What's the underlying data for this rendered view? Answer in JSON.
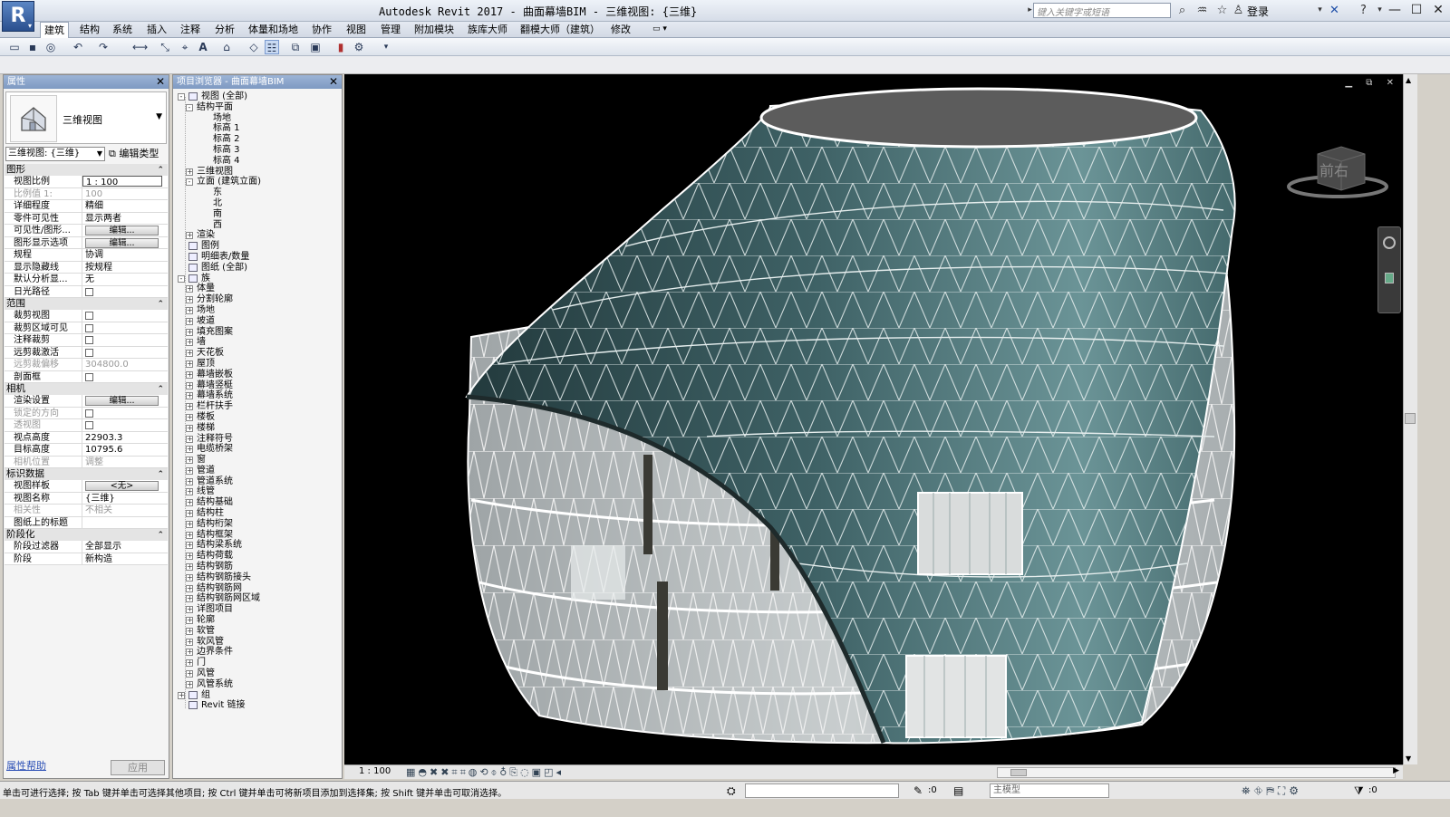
{
  "app": {
    "logo_letter": "R",
    "title": "Autodesk Revit 2017 -    曲面幕墙BIM - 三维视图: {三维}",
    "search_placeholder": "键入关键字或短语",
    "login": "登录"
  },
  "ribbon": {
    "tabs": [
      "建筑",
      "结构",
      "系统",
      "插入",
      "注释",
      "分析",
      "体量和场地",
      "协作",
      "视图",
      "管理",
      "附加模块",
      "族库大师",
      "翻模大师（建筑）",
      "修改"
    ],
    "active": "建筑"
  },
  "properties": {
    "panel_title": "属性",
    "type_name": "三维视图",
    "instance_selector": "三维视图: {三维}",
    "edit_type": "编辑类型",
    "sections": [
      {
        "title": "图形",
        "rows": [
          {
            "k": "视图比例",
            "v": "1 : 100",
            "kind": "input"
          },
          {
            "k": "比例值 1:",
            "v": "100",
            "dis": true
          },
          {
            "k": "详细程度",
            "v": "精细"
          },
          {
            "k": "零件可见性",
            "v": "显示两者"
          },
          {
            "k": "可见性/图形...",
            "v": "编辑...",
            "kind": "button"
          },
          {
            "k": "图形显示选项",
            "v": "编辑...",
            "kind": "button"
          },
          {
            "k": "规程",
            "v": "协调"
          },
          {
            "k": "显示隐藏线",
            "v": "按规程"
          },
          {
            "k": "默认分析显...",
            "v": "无"
          },
          {
            "k": "日光路径",
            "v": "",
            "kind": "check"
          }
        ]
      },
      {
        "title": "范围",
        "rows": [
          {
            "k": "裁剪视图",
            "v": "",
            "kind": "check"
          },
          {
            "k": "裁剪区域可见",
            "v": "",
            "kind": "check"
          },
          {
            "k": "注释裁剪",
            "v": "",
            "kind": "check"
          },
          {
            "k": "远剪裁激活",
            "v": "",
            "kind": "check"
          },
          {
            "k": "远剪裁偏移",
            "v": "304800.0",
            "dis": true
          },
          {
            "k": "剖面框",
            "v": "",
            "kind": "check"
          }
        ]
      },
      {
        "title": "相机",
        "rows": [
          {
            "k": "渲染设置",
            "v": "编辑...",
            "kind": "button"
          },
          {
            "k": "锁定的方向",
            "v": "",
            "kind": "check",
            "dis": true
          },
          {
            "k": "透视图",
            "v": "",
            "kind": "check",
            "dis": true
          },
          {
            "k": "视点高度",
            "v": "22903.3"
          },
          {
            "k": "目标高度",
            "v": "10795.6"
          },
          {
            "k": "相机位置",
            "v": "调整",
            "dis": true
          }
        ]
      },
      {
        "title": "标识数据",
        "rows": [
          {
            "k": "视图样板",
            "v": "<无>",
            "kind": "button"
          },
          {
            "k": "视图名称",
            "v": "{三维}"
          },
          {
            "k": "相关性",
            "v": "不相关",
            "dis": true
          },
          {
            "k": "图纸上的标题",
            "v": ""
          }
        ]
      },
      {
        "title": "阶段化",
        "rows": [
          {
            "k": "阶段过滤器",
            "v": "全部显示"
          },
          {
            "k": "阶段",
            "v": "新构造"
          }
        ]
      }
    ],
    "help_link": "属性帮助",
    "apply": "应用"
  },
  "browser": {
    "panel_title": "项目浏览器 - 曲面幕墙BIM",
    "nodes": [
      {
        "t": "视图 (全部)",
        "d": 0,
        "e": "-",
        "icon": true
      },
      {
        "t": "结构平面",
        "d": 1,
        "e": "-"
      },
      {
        "t": "场地",
        "d": 3
      },
      {
        "t": "标高 1",
        "d": 3
      },
      {
        "t": "标高 2",
        "d": 3
      },
      {
        "t": "标高 3",
        "d": 3
      },
      {
        "t": "标高 4",
        "d": 3
      },
      {
        "t": "三维视图",
        "d": 1,
        "e": "+"
      },
      {
        "t": "立面 (建筑立面)",
        "d": 1,
        "e": "-"
      },
      {
        "t": "东",
        "d": 3
      },
      {
        "t": "北",
        "d": 3
      },
      {
        "t": "南",
        "d": 3
      },
      {
        "t": "西",
        "d": 3
      },
      {
        "t": "渲染",
        "d": 1,
        "e": "+"
      },
      {
        "t": "图例",
        "d": 0,
        "icon": true
      },
      {
        "t": "明细表/数量",
        "d": 0,
        "icon": true
      },
      {
        "t": "图纸 (全部)",
        "d": 0,
        "icon": true
      },
      {
        "t": "族",
        "d": 0,
        "e": "-",
        "icon": true
      },
      {
        "t": "体量",
        "d": 1,
        "e": "+"
      },
      {
        "t": "分割轮廓",
        "d": 1,
        "e": "+"
      },
      {
        "t": "场地",
        "d": 1,
        "e": "+"
      },
      {
        "t": "坡道",
        "d": 1,
        "e": "+"
      },
      {
        "t": "填充图案",
        "d": 1,
        "e": "+"
      },
      {
        "t": "墙",
        "d": 1,
        "e": "+"
      },
      {
        "t": "天花板",
        "d": 1,
        "e": "+"
      },
      {
        "t": "屋顶",
        "d": 1,
        "e": "+"
      },
      {
        "t": "幕墙嵌板",
        "d": 1,
        "e": "+"
      },
      {
        "t": "幕墙竖梃",
        "d": 1,
        "e": "+"
      },
      {
        "t": "幕墙系统",
        "d": 1,
        "e": "+"
      },
      {
        "t": "栏杆扶手",
        "d": 1,
        "e": "+"
      },
      {
        "t": "楼板",
        "d": 1,
        "e": "+"
      },
      {
        "t": "楼梯",
        "d": 1,
        "e": "+"
      },
      {
        "t": "注释符号",
        "d": 1,
        "e": "+"
      },
      {
        "t": "电缆桥架",
        "d": 1,
        "e": "+"
      },
      {
        "t": "窗",
        "d": 1,
        "e": "+"
      },
      {
        "t": "管道",
        "d": 1,
        "e": "+"
      },
      {
        "t": "管道系统",
        "d": 1,
        "e": "+"
      },
      {
        "t": "线管",
        "d": 1,
        "e": "+"
      },
      {
        "t": "结构基础",
        "d": 1,
        "e": "+"
      },
      {
        "t": "结构柱",
        "d": 1,
        "e": "+"
      },
      {
        "t": "结构桁架",
        "d": 1,
        "e": "+"
      },
      {
        "t": "结构框架",
        "d": 1,
        "e": "+"
      },
      {
        "t": "结构梁系统",
        "d": 1,
        "e": "+"
      },
      {
        "t": "结构荷载",
        "d": 1,
        "e": "+"
      },
      {
        "t": "结构钢筋",
        "d": 1,
        "e": "+"
      },
      {
        "t": "结构钢筋接头",
        "d": 1,
        "e": "+"
      },
      {
        "t": "结构钢筋网",
        "d": 1,
        "e": "+"
      },
      {
        "t": "结构钢筋网区域",
        "d": 1,
        "e": "+"
      },
      {
        "t": "详图项目",
        "d": 1,
        "e": "+"
      },
      {
        "t": "轮廓",
        "d": 1,
        "e": "+"
      },
      {
        "t": "软管",
        "d": 1,
        "e": "+"
      },
      {
        "t": "软风管",
        "d": 1,
        "e": "+"
      },
      {
        "t": "边界条件",
        "d": 1,
        "e": "+"
      },
      {
        "t": "门",
        "d": 1,
        "e": "+"
      },
      {
        "t": "风管",
        "d": 1,
        "e": "+"
      },
      {
        "t": "风管系统",
        "d": 1,
        "e": "+"
      },
      {
        "t": "组",
        "d": 0,
        "e": "+",
        "icon": true
      },
      {
        "t": "Revit 链接",
        "d": 0,
        "icon": true
      }
    ]
  },
  "viewport": {
    "viewcube_label": "前右",
    "scale": "1 : 100"
  },
  "status": {
    "text": "单击可进行选择; 按 Tab 键并单击可选择其他项目; 按 Ctrl 键并单击可将新项目添加到选择集; 按 Shift 键并单击可取消选择。",
    "workset_count": ":0",
    "model_field": "主模型",
    "filter_count": ":0"
  }
}
